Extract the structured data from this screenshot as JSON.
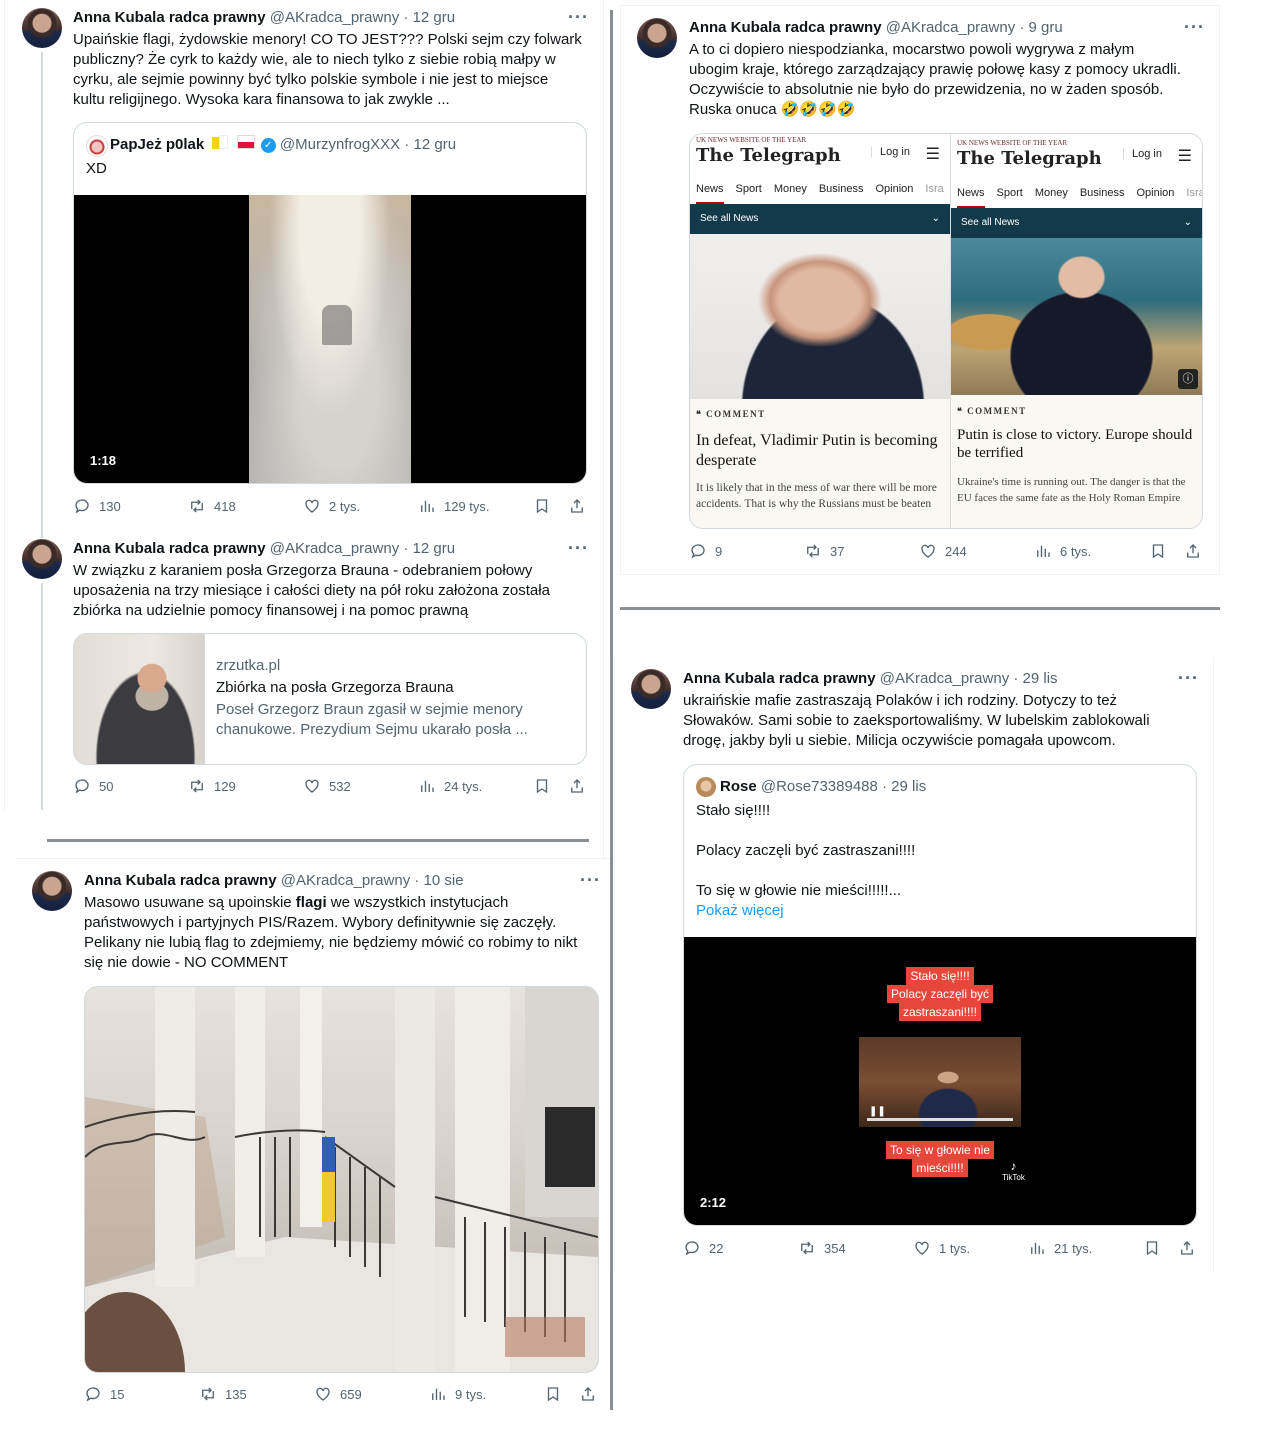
{
  "tweet1": {
    "name": "Anna Kubala radca prawny",
    "handle_time": "@AKradca_prawny · 12 gru",
    "lines": [
      "Upaińskie flagi, żydowskie menory! CO TO JEST??? Polski sejm czy folwark",
      "publiczny? Że cyrk to każdy wie, ale to niech tylko z siebie robią małpy w",
      "cyrku, ale sejmie powinny być tylko polskie symbole i nie jest to miejsce",
      "kultu religijnego. Wysoka kara finansowa to jak zwykle ..."
    ],
    "quote": {
      "name": "PapJeż p0lak",
      "handle_time": "@MurzynfrogXXX · 12 gru",
      "text": "XD",
      "duration": "1:18"
    },
    "stats": {
      "replies": "130",
      "retweets": "418",
      "likes": "2 tys.",
      "views": "129 tys."
    }
  },
  "tweet2": {
    "name": "Anna Kubala radca prawny",
    "handle_time": "@AKradca_prawny · 12 gru",
    "lines": [
      "W związku z karaniem posła Grzegorza Brauna  - odebraniem połowy",
      "uposażenia na trzy miesiące i całości  diety na pół roku założona została",
      "zbiórka na udzielnie pomocy finansowej i na pomoc prawną"
    ],
    "card": {
      "domain": "zrzutka.pl",
      "title": "Zbiórka na posła Grzegorza Brauna",
      "desc": [
        "Poseł Grzegorz Braun zgasił w sejmie menory",
        "chanukowe. Prezydium Sejmu ukarało posła ..."
      ]
    },
    "stats": {
      "replies": "50",
      "retweets": "129",
      "likes": "532",
      "views": "24 tys."
    }
  },
  "tweet3": {
    "name": "Anna Kubala radca prawny",
    "handle_time": "@AKradca_prawny · 10 sie",
    "lines_pre": "Masowo usuwane są upoinskie ",
    "lines_bold": "flagi",
    "lines_post": " we wszystkich instytucjach",
    "lines": [
      "państwowych i partyjnych PIS/Razem.  Wybory definitywnie się zaczęły.",
      "Pelikany nie lubią flag to zdejmiemy, nie będziemy mówić co robimy  to nikt",
      "się nie dowie  - NO COMMENT"
    ],
    "stats": {
      "replies": "15",
      "retweets": "135",
      "likes": "659",
      "views": "9 tys."
    }
  },
  "tweet4": {
    "name": "Anna Kubala radca prawny",
    "handle_time": "@AKradca_prawny · 9 gru",
    "lines": [
      "A to ci dopiero niespodzianka, mocarstwo powoli wygrywa z małym",
      "ubogim kraje, którego zarządzający prawię połowę kasy  z pomocy ukradli.",
      "Oczywiście to absolutnie nie było do przewidzenia, no w żaden sposób.",
      "Ruska onuca 🤣🤣🤣🤣"
    ],
    "telegraph": {
      "banner": "UK NEWS WEBSITE OF THE YEAR",
      "logo": "The Telegraph",
      "login": "Log in",
      "nav": [
        "News",
        "Sport",
        "Money",
        "Business",
        "Opinion",
        "Isra"
      ],
      "see_all": "See all News",
      "comment": "❝ COMMENT",
      "left_headline": "In defeat, Vladimir Putin is becoming desperate",
      "left_sub": "It is likely that in the mess of war there will be more accidents. That is why the Russians must be beaten",
      "right_headline": "Putin is close to victory. Europe should be terrified",
      "right_sub": "Ukraine's time is running out. The danger is that the EU faces the same fate as the Holy Roman Empire"
    },
    "stats": {
      "replies": "9",
      "retweets": "37",
      "likes": "244",
      "views": "6 tys."
    }
  },
  "tweet5": {
    "name": "Anna Kubala radca prawny",
    "handle_time": "@AKradca_prawny · 29 lis",
    "lines": [
      "ukraińskie mafie zastraszają Polaków i ich rodziny. Dotyczy to też",
      "Słowaków. Sami sobie to zaeksportowaliśmy. W lubelskim zablokowali",
      "drogę, jakby byli u siebie. Milicja oczywiście pomagała upowcom."
    ],
    "quote": {
      "name": "Rose",
      "handle_time": "@Rose73389488 · 29 lis",
      "lines": [
        "Stało się!!!!",
        "",
        "Polacy zaczęli być zastraszani!!!!",
        "",
        "To się w głowie nie mieści!!!!!..."
      ],
      "show_more": "Pokaż więcej",
      "overlay_top": [
        "Stało się!!!!",
        "Polacy zaczęli być",
        "zastraszani!!!!"
      ],
      "overlay_bottom": [
        "To się w głowie nie",
        "mieści!!!!"
      ],
      "tiktok": "TikTok",
      "duration": "2:12"
    },
    "stats": {
      "replies": "22",
      "retweets": "354",
      "likes": "1 tys.",
      "views": "21 tys."
    }
  }
}
